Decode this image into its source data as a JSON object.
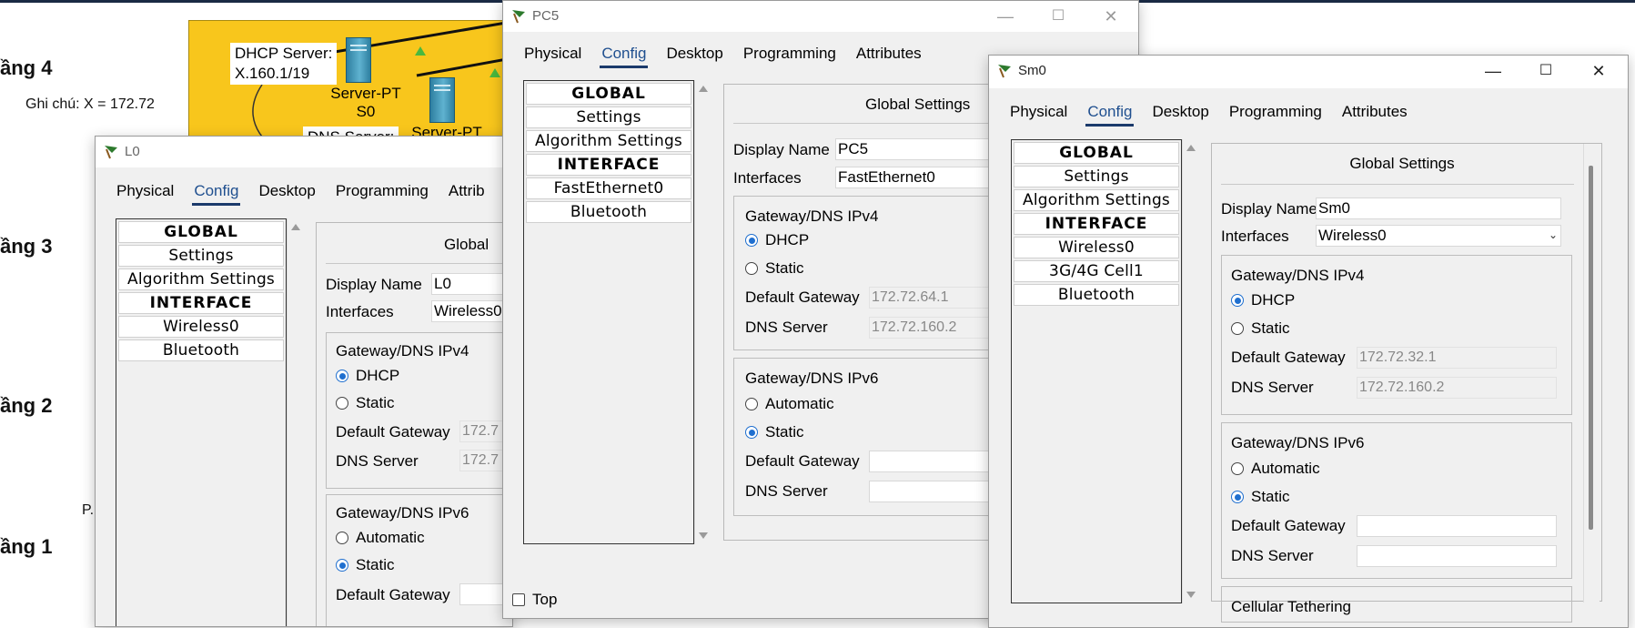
{
  "background": {
    "floors": [
      "ầng 4",
      "ầng 3",
      "ầng 2",
      "ầng 1"
    ],
    "note": "Ghi chú: X = 172.72",
    "p_label": "P.",
    "dhcp_server_label": "DHCP Server:",
    "dhcp_server_addr": "X.160.1/19",
    "server_pt_label": "Server-PT",
    "server_s0_label": "S0",
    "dns_server_label": "DNS Server:",
    "server_pt_label_2": "Server-PT",
    "area_color": "#f8c61c"
  },
  "tab_labels": [
    "Physical",
    "Config",
    "Desktop",
    "Programming",
    "Attributes"
  ],
  "windows": {
    "l0": {
      "title": "L0",
      "tabs": [
        "Physical",
        "Config",
        "Desktop",
        "Programming",
        "Attrib"
      ],
      "nav": [
        "GLOBAL",
        "Settings",
        "Algorithm Settings",
        "INTERFACE",
        "Wireless0",
        "Bluetooth"
      ],
      "panel_title": "Global",
      "display_name_label": "Display Name",
      "display_name": "L0",
      "interfaces_label": "Interfaces",
      "interfaces_value": "Wireless0",
      "ipv4_title": "Gateway/DNS IPv4",
      "dhcp": "DHCP",
      "static": "Static",
      "gateway_label": "Default Gateway",
      "gateway_value": "172.7",
      "dns_label": "DNS Server",
      "dns_value": "172.7",
      "ipv6_title": "Gateway/DNS IPv6",
      "automatic": "Automatic",
      "static6": "Static",
      "gateway6_label": "Default Gateway"
    },
    "pc5": {
      "title": "PC5",
      "nav": [
        "GLOBAL",
        "Settings",
        "Algorithm Settings",
        "INTERFACE",
        "FastEthernet0",
        "Bluetooth"
      ],
      "panel_title": "Global Settings",
      "display_name_label": "Display Name",
      "display_name": "PC5",
      "interfaces_label": "Interfaces",
      "interfaces_value": "FastEthernet0",
      "ipv4_title": "Gateway/DNS IPv4",
      "dhcp": "DHCP",
      "static": "Static",
      "gateway_label": "Default Gateway",
      "gateway_value": "172.72.64.1",
      "dns_label": "DNS Server",
      "dns_value": "172.72.160.2",
      "ipv6_title": "Gateway/DNS IPv6",
      "automatic": "Automatic",
      "static6": "Static",
      "gateway6_label": "Default Gateway",
      "dns6_label": "DNS Server",
      "top_checkbox_label": "Top"
    },
    "sm0": {
      "title": "Sm0",
      "nav": [
        "GLOBAL",
        "Settings",
        "Algorithm Settings",
        "INTERFACE",
        "Wireless0",
        "3G/4G Cell1",
        "Bluetooth"
      ],
      "panel_title": "Global Settings",
      "display_name_label": "Display Name",
      "display_name": "Sm0",
      "interfaces_label": "Interfaces",
      "interfaces_value": "Wireless0",
      "ipv4_title": "Gateway/DNS IPv4",
      "dhcp": "DHCP",
      "static": "Static",
      "gateway_label": "Default Gateway",
      "gateway_value": "172.72.32.1",
      "dns_label": "DNS Server",
      "dns_value": "172.72.160.2",
      "ipv6_title": "Gateway/DNS IPv6",
      "automatic": "Automatic",
      "static6": "Static",
      "gateway6_label": "Default Gateway",
      "dns6_label": "DNS Server",
      "cellular_label": "Cellular Tethering"
    }
  },
  "colors": {
    "accent": "#1f6fcf",
    "tab_underline": "#1b3a6b"
  }
}
